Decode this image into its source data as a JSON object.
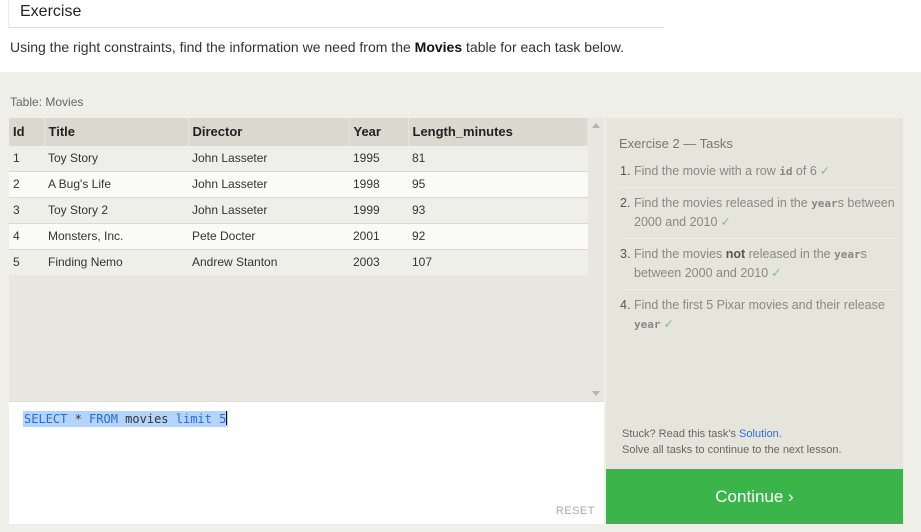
{
  "header": {
    "exercise_label": "Exercise",
    "instruction_prefix": "Using the right constraints, find the information we need from the ",
    "instruction_table": "Movies",
    "instruction_suffix": " table for each task below."
  },
  "table": {
    "label": "Table: Movies",
    "columns": [
      "Id",
      "Title",
      "Director",
      "Year",
      "Length_minutes"
    ],
    "rows": [
      [
        "1",
        "Toy Story",
        "John Lasseter",
        "1995",
        "81"
      ],
      [
        "2",
        "A Bug's Life",
        "John Lasseter",
        "1998",
        "95"
      ],
      [
        "3",
        "Toy Story 2",
        "John Lasseter",
        "1999",
        "93"
      ],
      [
        "4",
        "Monsters, Inc.",
        "Pete Docter",
        "2001",
        "92"
      ],
      [
        "5",
        "Finding Nemo",
        "Andrew Stanton",
        "2003",
        "107"
      ]
    ]
  },
  "editor": {
    "query_kw1": "SELECT",
    "query_star": " * ",
    "query_kw2": "FROM",
    "query_table": " movies ",
    "query_kw3": "limit",
    "query_num": " 5",
    "reset_label": "RESET"
  },
  "tasks": {
    "title": "Exercise 2 — Tasks",
    "items": [
      {
        "num": "1.",
        "pre": "Find the movie with a row ",
        "code": "id",
        "post": " of 6",
        "check": "✓"
      },
      {
        "num": "2.",
        "pre": "Find the movies released in the ",
        "code": "year",
        "post": "s between 2000 and 2010",
        "check": "✓"
      },
      {
        "num": "3.",
        "pre": "Find the movies ",
        "bold": "not",
        "mid": " released in the ",
        "code": "year",
        "post": "s between 2000 and 2010",
        "check": "✓"
      },
      {
        "num": "4.",
        "pre": "Find the first 5 Pixar movies and their release ",
        "code": "year",
        "post": "",
        "check": "✓"
      }
    ],
    "stuck_prefix": "Stuck? Read this task's ",
    "solution_link": "Solution",
    "stuck_suffix": ".",
    "solve_all": "Solve all tasks to continue to the next lesson."
  },
  "continue_label": "Continue ›",
  "colors": {
    "continue_green": "#3bb54a",
    "selection_blue": "#b3d4fc",
    "link_blue": "#2f6fd6",
    "check_green": "#7cc27c"
  }
}
